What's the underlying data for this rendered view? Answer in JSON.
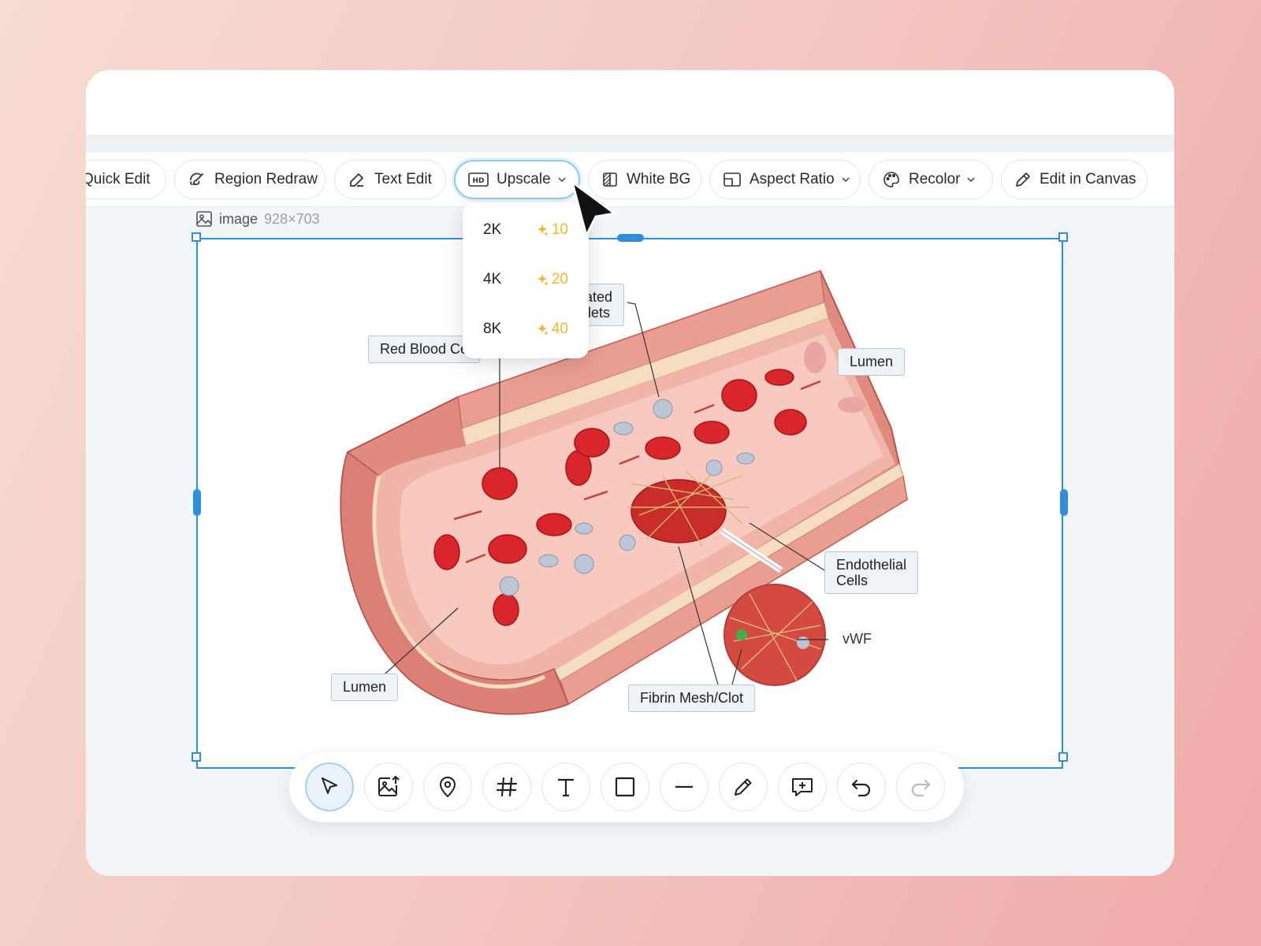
{
  "toolbar": {
    "items": [
      {
        "label": "Quick Edit",
        "icon": "magic-wand-icon"
      },
      {
        "label": "Region Redraw",
        "icon": "brush-refresh-icon"
      },
      {
        "label": "Text Edit",
        "icon": "pencil-icon"
      },
      {
        "label": "Upscale",
        "icon": "hd-icon",
        "active": true
      },
      {
        "label": "White BG",
        "icon": "background-icon"
      },
      {
        "label": "Aspect Ratio",
        "icon": "aspect-ratio-icon"
      },
      {
        "label": "Recolor",
        "icon": "palette-icon"
      },
      {
        "label": "Edit in Canvas",
        "icon": "pen-icon"
      }
    ]
  },
  "image_info": {
    "label": "image",
    "dimensions": "928×703"
  },
  "upscale_menu": {
    "options": [
      {
        "label": "2K",
        "cost": "10"
      },
      {
        "label": "4K",
        "cost": "20"
      },
      {
        "label": "8K",
        "cost": "40"
      }
    ]
  },
  "diagram": {
    "labels": {
      "red_blood_cells": "Red Blood Ce",
      "activated_platelets_line1": "rated",
      "activated_platelets_line2": "elets",
      "lumen_right": "Lumen",
      "endothelial_line1": "Endothelial",
      "endothelial_line2": "Cells",
      "vwf": "vWF",
      "fibrin": "Fibrin Mesh/Clot",
      "lumen_left": "Lumen"
    }
  },
  "bottom_tools": [
    {
      "name": "select-tool",
      "icon": "cursor-arrow-icon",
      "active": true
    },
    {
      "name": "add-image-tool",
      "icon": "image-upload-icon"
    },
    {
      "name": "pin-tool",
      "icon": "location-pin-icon"
    },
    {
      "name": "grid-tool",
      "icon": "hash-icon"
    },
    {
      "name": "text-tool",
      "icon": "text-t-icon"
    },
    {
      "name": "rectangle-tool",
      "icon": "square-icon"
    },
    {
      "name": "line-tool",
      "icon": "minus-icon"
    },
    {
      "name": "pencil-tool",
      "icon": "pencil-icon"
    },
    {
      "name": "comment-tool",
      "icon": "comment-plus-icon"
    },
    {
      "name": "undo-tool",
      "icon": "undo-icon"
    },
    {
      "name": "redo-tool",
      "icon": "redo-icon",
      "disabled": true
    }
  ],
  "colors": {
    "accent": "#2e8fde",
    "cost": "#f2b625",
    "vessel": "#d9716a"
  }
}
